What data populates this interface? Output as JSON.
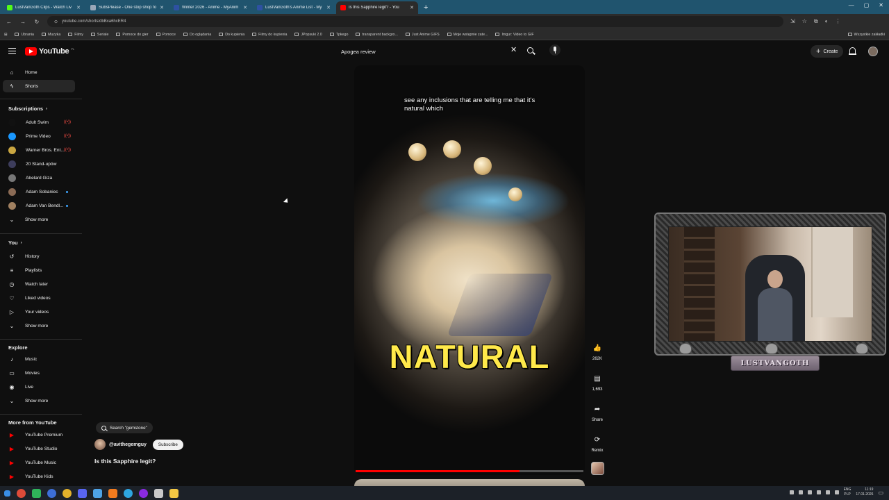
{
  "browser": {
    "tabs": [
      {
        "title": "LustVanGoth Clips - Watch Liv",
        "color": "#53fc18",
        "active": false
      },
      {
        "title": "SubsPlease - One stop shop fo",
        "color": "#9aa7b8",
        "active": false
      },
      {
        "title": "Winter 2026 - Anime - MyAnim",
        "color": "#2e51a2",
        "active": false
      },
      {
        "title": "LustVanGoth's Anime List - My",
        "color": "#2e51a2",
        "active": false
      },
      {
        "title": "Is this Sapphire legit? - You",
        "color": "#ff0000",
        "active": true
      }
    ],
    "new_tab": "+",
    "url": "youtube.com/shorts/dbBxa6hcER4",
    "bookmarks": [
      "Ubrania",
      "Muzyka",
      "Filmy",
      "Seriale",
      "Pomoce do gier",
      "Pomoce",
      "Do oglądania",
      "Do kupienia",
      "Filmy do kupienia",
      "JPopsuki 2.0",
      "Tpkego",
      "transparent backgro...",
      "Just Anime GIFS",
      "Moje wstępnie zate...",
      "Imgur: Video to GIF"
    ],
    "bookmarks_right": "Wszystkie zakładki"
  },
  "header": {
    "logo_text": "YouTube",
    "logo_country": "PL",
    "search_value": "Apogea review",
    "create_label": "Create"
  },
  "sidebar": {
    "main": [
      {
        "label": "Home",
        "icon": "home-icon",
        "glyph": "⌂"
      },
      {
        "label": "Shorts",
        "icon": "shorts-icon",
        "glyph": "ϟ"
      }
    ],
    "subscriptions_heading": "Subscriptions",
    "subscriptions": [
      {
        "label": "Adult Swim",
        "color": "#111111",
        "live": true
      },
      {
        "label": "Prime Video",
        "color": "#1a98ff",
        "live": true
      },
      {
        "label": "Warner Bros. Ent...",
        "color": "#c9a641",
        "live": true
      },
      {
        "label": "20 Stand-upów",
        "color": "#3d3d5c",
        "live": false
      },
      {
        "label": "Abelard Giza",
        "color": "#777777",
        "live": false
      },
      {
        "label": "Adam Sobaniec",
        "color": "#8b6b55",
        "live": false,
        "new": true
      },
      {
        "label": "Adam Van Bendl...",
        "color": "#a08060",
        "live": false,
        "new": true
      }
    ],
    "show_more": "Show more",
    "you_heading": "You",
    "you_items": [
      {
        "label": "History",
        "glyph": "↺"
      },
      {
        "label": "Playlists",
        "glyph": "≡"
      },
      {
        "label": "Watch later",
        "glyph": "◷"
      },
      {
        "label": "Liked videos",
        "glyph": "♡"
      },
      {
        "label": "Your videos",
        "glyph": "▷"
      }
    ],
    "explore_heading": "Explore",
    "explore_items": [
      {
        "label": "Music",
        "glyph": "♪"
      },
      {
        "label": "Movies",
        "glyph": "▭"
      },
      {
        "label": "Live",
        "glyph": "◉"
      }
    ],
    "more_heading": "More from YouTube",
    "more_items": [
      {
        "label": "YouTube Premium"
      },
      {
        "label": "YouTube Studio"
      },
      {
        "label": "YouTube Music"
      },
      {
        "label": "YouTube Kids"
      }
    ]
  },
  "short": {
    "caption": "see any inclusions that are telling me that it's natural which",
    "big_word": "NATURAL",
    "progress": 0.72,
    "search_chip": "Search \"gemstone\"",
    "channel": "@avithegemguy",
    "subscribe": "Subscribe",
    "title": "Is this Sapphire legit?"
  },
  "actions": [
    {
      "name": "like",
      "glyph": "👍",
      "label": "262K"
    },
    {
      "name": "comment",
      "glyph": "▤",
      "label": "1,693"
    },
    {
      "name": "share",
      "glyph": "➦",
      "label": "Share"
    },
    {
      "name": "remix",
      "glyph": "⟳",
      "label": "Remix"
    }
  ],
  "webcam": {
    "nameplate": "LUSTVANGOTH"
  },
  "taskbar": {
    "lang": "ENG",
    "layout": "PLP",
    "time": "11:19",
    "date": "17.01.2026"
  }
}
